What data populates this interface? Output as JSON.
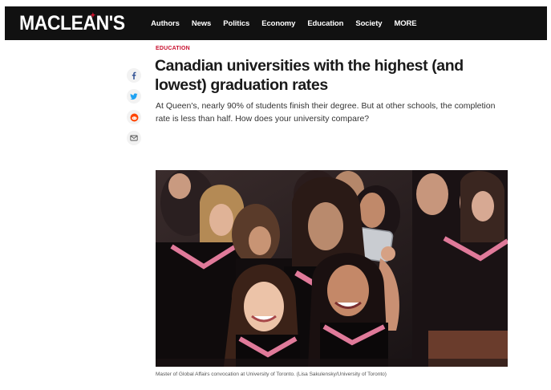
{
  "header": {
    "logo": "MACLEAN'S",
    "nav": [
      "Authors",
      "News",
      "Politics",
      "Economy",
      "Education",
      "Society",
      "MORE"
    ]
  },
  "share": {
    "icons": [
      "facebook-icon",
      "twitter-icon",
      "reddit-icon",
      "email-icon"
    ]
  },
  "article": {
    "section": "EDUCATION",
    "headline": "Canadian universities with the highest (and lowest) graduation rates",
    "dek": "At Queen's, nearly 90% of students finish their degree. But at other schools, the completion rate is less than half. How does your university compare?",
    "caption": "Master of Global Affairs convocation at University of Toronto. (Lisa Sakulensky/University of Toronto)"
  },
  "colors": {
    "brand_red": "#c8102e",
    "navbar": "#111111",
    "gown_trim": "#e07a9a"
  }
}
